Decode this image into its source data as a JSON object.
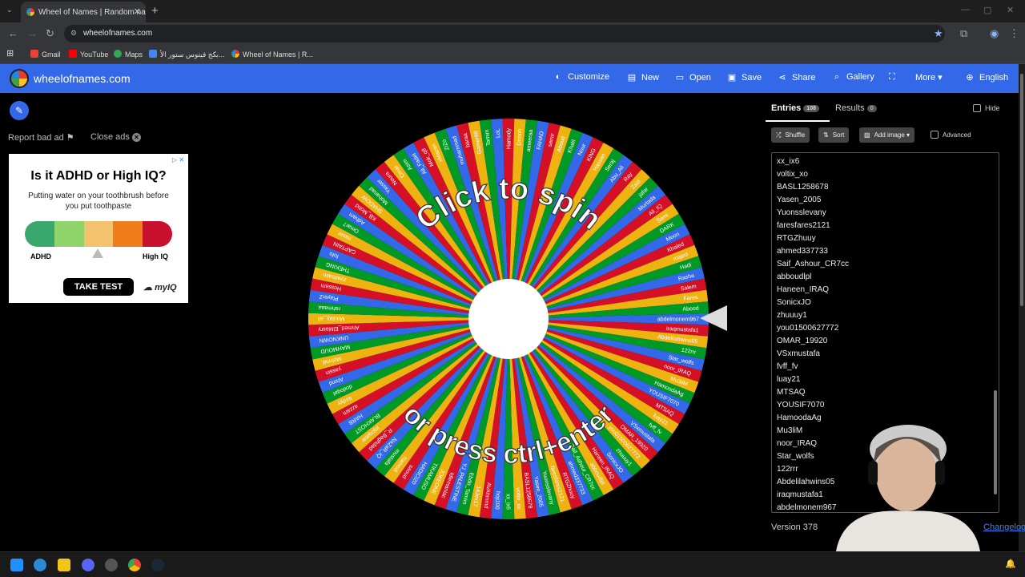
{
  "browser": {
    "tab_title": "Wheel of Names | Random name...",
    "url": "wheelofnames.com",
    "bookmarks": [
      "Gmail",
      "YouTube",
      "Maps",
      "بكج فيتوس ستور الأ...",
      "Wheel of Names | R..."
    ]
  },
  "header": {
    "brand": "wheelofnames.com",
    "menu": [
      "Customize",
      "New",
      "Open",
      "Save",
      "Share",
      "Gallery",
      "More",
      "English"
    ]
  },
  "ads": {
    "report": "Report bad ad",
    "close": "Close ads",
    "headline": "Is it ADHD or High IQ?",
    "sub": "Putting water on your toothbrush before you put toothpaste",
    "label_left": "ADHD",
    "label_right": "High IQ",
    "cta": "TAKE TEST",
    "brand": "myIQ",
    "bar_colors": [
      "#3aa76d",
      "#8fd36b",
      "#f3c26e",
      "#ef7d1a",
      "#c8102e"
    ]
  },
  "wheel": {
    "text_top": "Click to spin",
    "text_bottom": "or press ctrl+enter",
    "colors": [
      "#3369e8",
      "#d50f25",
      "#eeb211",
      "#009925"
    ],
    "labels": [
      "abdelmonem967",
      "iraqmustafa1",
      "Abdelilahwins05",
      "122rrr",
      "Star_wolfs",
      "noor_IRAQ",
      "Mu3liM",
      "HamoodaAg",
      "YOUSIF7070",
      "MTSAQ",
      "luay21",
      "fvff_fv",
      "VSxmustafa",
      "OMAR_19920",
      "you01500627772",
      "zhuuuy1",
      "SonicxJO",
      "Haneen_IRAQ",
      "abboudlpl",
      "Saif_Ashour_CR7cc",
      "ahmed337733",
      "RTGZhuuy",
      "faresfares2121",
      "Yuonsslevany",
      "Yasen_2005",
      "BASL1258678",
      "voltix_xo",
      "xx_ix6",
      "hoji100",
      "AVAhmmd",
      "14Jex17",
      "Ebdo_Tamim",
      "YJ_PALESTINE",
      "Idlemaniac",
      "JOKEONE",
      "TIKAMUSO",
      "HADICI20",
      "saoud",
      "hamodi",
      "mustafa",
      "NaZaR_iQ",
      "R_Baghdad",
      "jojoqatar",
      "BLAKHOST",
      "HARB",
      "azzam",
      "lordyy",
      "dodoqat",
      "Ahmd",
      "yassin",
      "Mohmd",
      "MAHMOUD",
      "UNKNOWN",
      "Ahmed_ElMasry",
      "Moulay_ali",
      "rahmaaa",
      "PlayerZ",
      "Hossam",
      "zyadsalm",
      "THEKING",
      "fofo",
      "CAPTAIN",
      "naser",
      "Omar7",
      "Adham",
      "KB_Mohd",
      "SHADOW",
      "Mohanad",
      "Yasser",
      "Noura",
      "Omar",
      "Asim",
      "Ali_Fadel",
      "Mok_q8",
      "xMazen",
      "ZiZo",
      "muhammad",
      "baraa",
      "Gamer99",
      "Tamim",
      "LoL",
      "Hamody",
      "Drmoh",
      "ameeraa",
      "FAHAD",
      "samir",
      "Aboud",
      "Khalil",
      "Nour",
      "KING",
      "Hassan",
      "Seraj",
      "Abu_Ali",
      "Ray",
      "Zaid",
      "jafar",
      "Murtada",
      "Ali_IQ",
      "Sami",
      "DARK",
      "Moon",
      "Khaled",
      "majed",
      "Hadi",
      "Rasha",
      "Salem",
      "Fares",
      "Abood"
    ]
  },
  "panel": {
    "entries_tab": "Entries",
    "entries_count": "108",
    "results_tab": "Results",
    "results_count": "0",
    "hide": "Hide",
    "shuffle": "Shuffle",
    "sort": "Sort",
    "add_image": "Add image",
    "advanced": "Advanced",
    "visible_entries": [
      "xx_ix6",
      "voltix_xo",
      "BASL1258678",
      "Yasen_2005",
      "Yuonsslevany",
      "faresfares2121",
      "RTGZhuuy",
      "ahmed337733",
      "Saif_Ashour_CR7cc",
      "abboudlpl",
      "Haneen_IRAQ",
      "SonicxJO",
      "zhuuuy1",
      "you01500627772",
      "OMAR_19920",
      "VSxmustafa",
      "fvff_fv",
      "luay21",
      "MTSAQ",
      "YOUSIF7070",
      "HamoodaAg",
      "Mu3liM",
      "noor_IRAQ",
      "Star_wolfs",
      "122rrr",
      "Abdelilahwins05",
      "iraqmustafa1",
      "abdelmonem967"
    ],
    "version": "Version 378",
    "changelog": "Changelog"
  }
}
